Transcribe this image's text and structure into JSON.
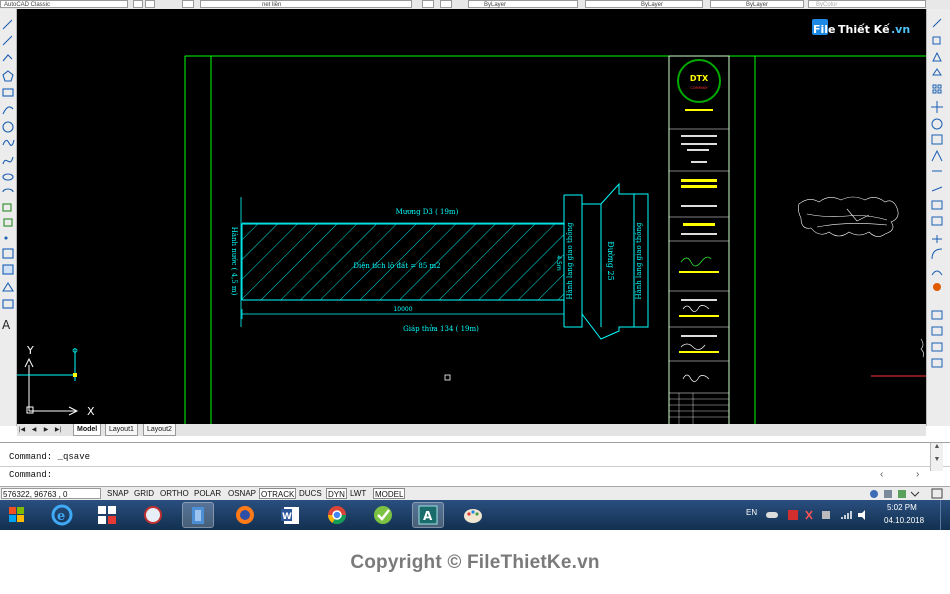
{
  "toolbar": {
    "workspace": "AutoCAD Classic",
    "layer": "net liền",
    "color": "ByLayer",
    "linetype": "ByLayer",
    "lineweight": "ByLayer",
    "plotstyle": "ByColor"
  },
  "watermark_top": {
    "part1": "File",
    "part2": "Thiết Kế",
    "part3": ".vn"
  },
  "drawing": {
    "top_road": "Mương D3 ( 19m)",
    "area_text": "Diện tích lô đất = 85 m2",
    "left_dim": "Hành nước ( 4,5 m)",
    "bottom_dim": "10000",
    "bottom_road": "Giáp thửa 134 ( 19m)",
    "side_dim": "4.5m",
    "corridor_left": "Hành lang giao thông",
    "road_right": "Đường 25",
    "corridor_right": "Hành lang giao thông",
    "ucs_y": "Y",
    "ucs_x": "X"
  },
  "titleblock": {
    "logo": "DTX",
    "logo_sub": "COMPANY"
  },
  "layout_tabs": [
    "Model",
    "Layout1",
    "Layout2"
  ],
  "command": {
    "history": "Command:  _qsave",
    "prompt": "Command:"
  },
  "status": {
    "coordinates": "576322, 96763 , 0",
    "toggles": [
      "SNAP",
      "GRID",
      "ORTHO",
      "POLAR",
      "OSNAP",
      "OTRACK",
      "DUCS",
      "DYN",
      "LWT",
      "MODEL"
    ],
    "active": [
      "OTRACK",
      "DYN",
      "MODEL"
    ]
  },
  "taskbar": {
    "language": "EN",
    "time": "5:02 PM",
    "date": "04.10.2018"
  },
  "copyright": "Copyright © FileThietKe.vn",
  "colors": {
    "canvas": "#000000",
    "cyan": "#00ffff",
    "green": "#00ff00",
    "yellow": "#ffff00"
  }
}
